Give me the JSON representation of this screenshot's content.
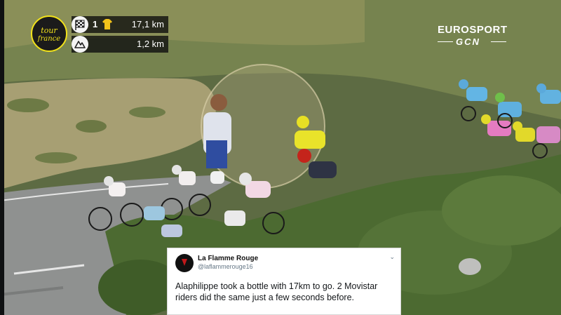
{
  "broadcast": {
    "race_logo": {
      "line1": "tour",
      "line2": "france"
    },
    "stage_position": "1",
    "distance_to_finish": "17,1 km",
    "distance_to_climb": "1,2 km",
    "icons": [
      "checkered-flag-icon",
      "yellow-jersey-icon",
      "mountain-icon"
    ],
    "channel": {
      "name": "EUROSPORT",
      "partner": "GCN"
    }
  },
  "tweet": {
    "author_name": "La Flamme Rouge",
    "author_handle": "@laflammerouge16",
    "caret": "⌄",
    "text": "Alaphilippe took a bottle with 17km to go. 2 Movistar riders did the same just a few seconds before."
  },
  "colors": {
    "tdf_yellow": "#f2e21a",
    "avatar_red": "#c0191b",
    "grass": "#5f6f45",
    "road": "#8f9190"
  }
}
